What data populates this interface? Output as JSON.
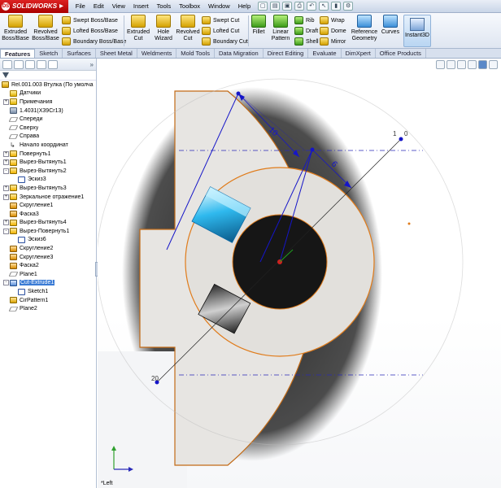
{
  "app": {
    "logo": "SOLIDWORKS",
    "menus": [
      "File",
      "Edit",
      "View",
      "Insert",
      "Tools",
      "Toolbox",
      "Window",
      "Help"
    ]
  },
  "ribbon": {
    "extruded_boss": "Extruded Boss/Base",
    "revolved_boss": "Revolved Boss/Base",
    "swept_boss": "Swept Boss/Base",
    "lofted_boss": "Lofted Boss/Base",
    "boundary_boss": "Boundary Boss/Base",
    "extruded_cut": "Extruded Cut",
    "hole_wizard": "Hole Wizard",
    "revolved_cut": "Revolved Cut",
    "swept_cut": "Swept Cut",
    "lofted_cut": "Lofted Cut",
    "boundary_cut": "Boundary Cut",
    "fillet": "Fillet",
    "linear_pattern": "Linear Pattern",
    "rib": "Rib",
    "draft": "Draft",
    "shell": "Shell",
    "wrap": "Wrap",
    "dome": "Dome",
    "mirror": "Mirror",
    "reference_geometry": "Reference Geometry",
    "curves": "Curves",
    "instant3d": "Instant3D"
  },
  "tabs": [
    "Features",
    "Sketch",
    "Surfaces",
    "Sheet Metal",
    "Weldments",
    "Mold Tools",
    "Data Migration",
    "Direct Editing",
    "Evaluate",
    "DimXpert",
    "Office Products"
  ],
  "tree": {
    "root": "Rel.001.003 Втулка (По умолча",
    "items": [
      {
        "label": "Датчики",
        "icon": "folder",
        "exp": ""
      },
      {
        "label": "Примечания",
        "icon": "note",
        "exp": "+"
      },
      {
        "label": "1.4031(X39Cr13)",
        "icon": "mat",
        "exp": ""
      },
      {
        "label": "Спереди",
        "icon": "plane",
        "exp": ""
      },
      {
        "label": "Сверху",
        "icon": "plane",
        "exp": ""
      },
      {
        "label": "Справа",
        "icon": "plane",
        "exp": ""
      },
      {
        "label": "Начало координат",
        "icon": "origin",
        "exp": ""
      },
      {
        "label": "Повернуть1",
        "icon": "feat",
        "exp": "+"
      },
      {
        "label": "Вырез-Вытянуть1",
        "icon": "feat",
        "exp": "+"
      },
      {
        "label": "Вырез-Вытянуть2",
        "icon": "feat",
        "exp": "-"
      },
      {
        "label": "Эскиз3",
        "icon": "sketch",
        "exp": "",
        "indent": 1
      },
      {
        "label": "Вырез-Вытянуть3",
        "icon": "feat",
        "exp": "+"
      },
      {
        "label": "Зеркальное отражение1",
        "icon": "feat",
        "exp": "+"
      },
      {
        "label": "Скругление1",
        "icon": "fillet",
        "exp": ""
      },
      {
        "label": "Фаска3",
        "icon": "fillet",
        "exp": ""
      },
      {
        "label": "Вырез-Вытянуть4",
        "icon": "feat",
        "exp": "+"
      },
      {
        "label": "Вырез-Повернуть1",
        "icon": "feat",
        "exp": "-"
      },
      {
        "label": "Эскиз6",
        "icon": "sketch",
        "exp": "",
        "indent": 1
      },
      {
        "label": "Скругление2",
        "icon": "fillet",
        "exp": ""
      },
      {
        "label": "Скругление3",
        "icon": "fillet",
        "exp": ""
      },
      {
        "label": "Фаска2",
        "icon": "fillet",
        "exp": ""
      },
      {
        "label": "Plane1",
        "icon": "plane",
        "exp": ""
      },
      {
        "label": "Cut-Extrude1",
        "icon": "cut",
        "exp": "-",
        "selected": true
      },
      {
        "label": "Sketch1",
        "icon": "sketch",
        "exp": "",
        "indent": 1
      },
      {
        "label": "CirPattern1",
        "icon": "pattern",
        "exp": ""
      },
      {
        "label": "Plane2",
        "icon": "plane",
        "exp": ""
      }
    ]
  },
  "viewport": {
    "view_name": "*Left",
    "dimensions": {
      "d1": "10",
      "d2": "6"
    },
    "point_labels": {
      "p1": "1",
      "p2": "0",
      "p3": "20"
    }
  },
  "colors": {
    "part_fill": "#e7e5e2",
    "edge_orange": "#e07b1a",
    "sketch_blue": "#1515c8",
    "selected_blue": "#3a7bd5"
  }
}
